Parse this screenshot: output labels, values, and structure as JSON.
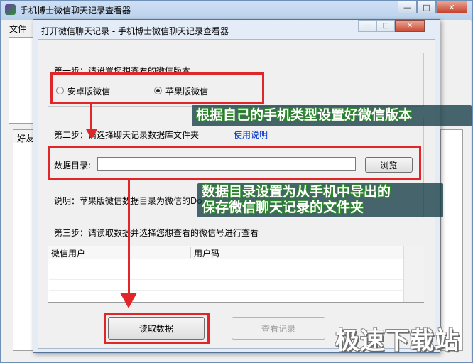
{
  "main_window": {
    "title": "手机博士微信聊天记录查看器",
    "menu": [
      "文件"
    ],
    "controls": {
      "minimize": "—",
      "maximize": "□",
      "close": "✕"
    },
    "background_list_header": "好友"
  },
  "dialog": {
    "title": "打开微信聊天记录 - 手机博士微信聊天记录查看器",
    "controls": {
      "minimize": "—",
      "maximize": "□",
      "close": "✕"
    },
    "step1": {
      "label": "第一步：请设置您想查看的微信版本",
      "options": [
        {
          "label": "安卓版微信",
          "checked": false
        },
        {
          "label": "苹果版微信",
          "checked": true
        }
      ]
    },
    "step2": {
      "label": "第二步：请选择聊天记录数据库文件夹",
      "help_link": "使用说明",
      "dir_label": "数据目录:",
      "dir_value": "",
      "browse_button": "浏览",
      "note": "说明：苹果版微信数据目录为微信的Do"
    },
    "step3": {
      "label": "第三步：请读取数据并选择您想查看的微信号进行查看",
      "columns": [
        "微信用户",
        "用户码"
      ],
      "rows": []
    },
    "buttons": {
      "read": "读取数据",
      "view": "查看记录"
    }
  },
  "annotations": {
    "callout1": "根据自己的手机类型设置好微信版本",
    "callout2_line1": "数据目录设置为从手机中导出的",
    "callout2_line2": "保存微信聊天记录的文件夹",
    "watermark": "极速下载站"
  },
  "colors": {
    "accent_red": "#e1262a",
    "link_blue": "#0033cc",
    "callout_green": "#2f8f2f"
  }
}
